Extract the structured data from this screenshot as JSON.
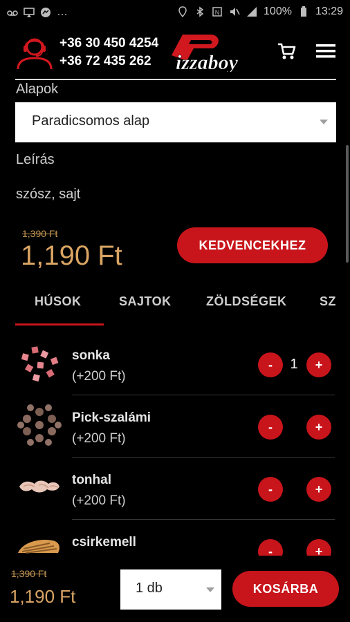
{
  "status_bar": {
    "battery": "100%",
    "time": "13:29",
    "left_icons": [
      "voicemail-icon",
      "airplay-icon",
      "messenger-icon",
      "more-dots"
    ],
    "right_icons": [
      "location-icon",
      "bluetooth-icon",
      "nfc-icon",
      "mute-icon",
      "signal-icon",
      "battery-icon"
    ]
  },
  "header": {
    "phone_1": "+36 30 450 4254",
    "phone_2": "+36 72 435 262",
    "logo_text": "Pizzaboy"
  },
  "form": {
    "bases_label": "Alapok",
    "bases_selected": "Paradicsomos alap",
    "description_label": "Leírás",
    "description": "szósz, sajt"
  },
  "pricing": {
    "old_price": "1,390 Ft",
    "price": "1,190 Ft",
    "favorite_label": "KEDVENCEKHEZ"
  },
  "tabs": [
    {
      "label": "HÚSOK",
      "active": true
    },
    {
      "label": "SAJTOK",
      "active": false
    },
    {
      "label": "ZÖLDSÉGEK",
      "active": false
    },
    {
      "label": "SZ",
      "active": false
    }
  ],
  "ingredients": [
    {
      "name": "sonka",
      "price": "(+200 Ft)",
      "quantity": "1",
      "image": "ham-cubes"
    },
    {
      "name": "Pick-szalámi",
      "price": "(+200 Ft)",
      "quantity": "",
      "image": "salami-slices"
    },
    {
      "name": "tonhal",
      "price": "(+200 Ft)",
      "quantity": "",
      "image": "tuna-chunks"
    },
    {
      "name": "csirkemell",
      "price": "",
      "quantity": "",
      "image": "chicken-breast"
    }
  ],
  "buttons": {
    "minus": "-",
    "plus": "+"
  },
  "footer": {
    "old_price": "1,390 Ft",
    "price": "1,190 Ft",
    "quantity_selected": "1 db",
    "add_to_cart_label": "KOSÁRBA"
  },
  "colors": {
    "accent": "#c8151b",
    "price": "#d9a463",
    "background": "#000000"
  }
}
